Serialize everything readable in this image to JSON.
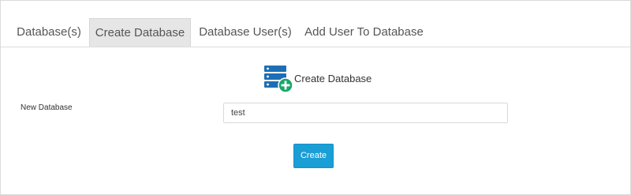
{
  "tabs": [
    {
      "label": "Database(s)",
      "active": false
    },
    {
      "label": "Create Database",
      "active": true
    },
    {
      "label": "Database User(s)",
      "active": false
    },
    {
      "label": "Add User To Database",
      "active": false
    }
  ],
  "section": {
    "title": "Create Database",
    "icon": "database-add-icon"
  },
  "form": {
    "new_database_label": "New Database",
    "new_database_value": "test",
    "create_button_label": "Create"
  },
  "colors": {
    "accent": "#1a9ed6",
    "icon_blue": "#1c6fb5",
    "icon_green": "#1aa56a",
    "active_tab_bg": "#e6e6e6"
  }
}
